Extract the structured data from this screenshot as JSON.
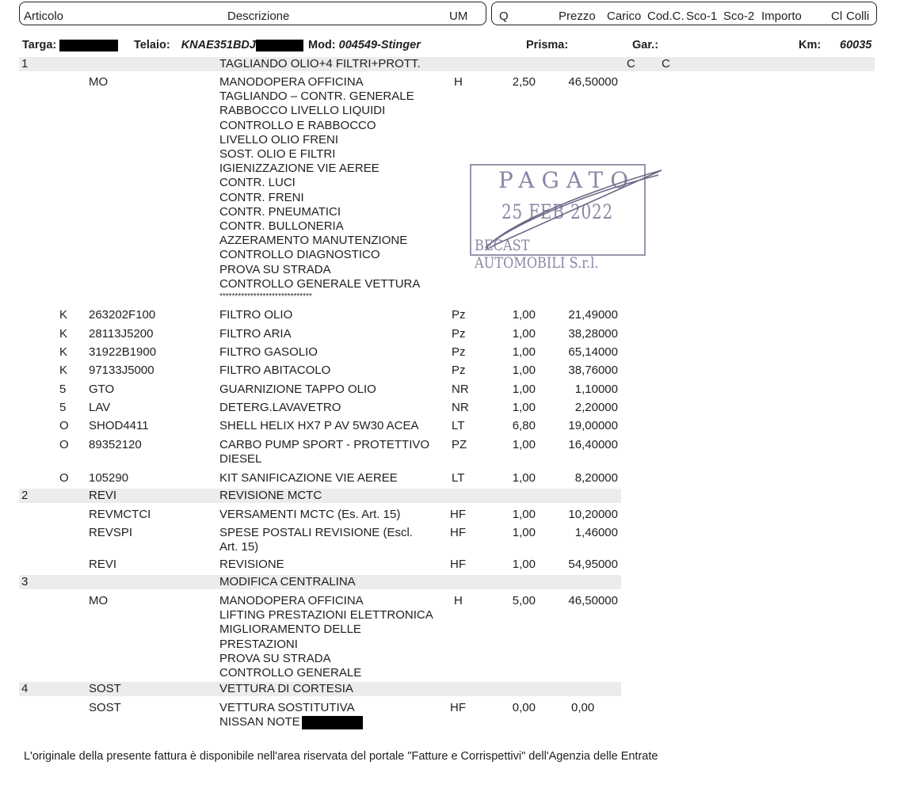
{
  "header": {
    "articolo": "Articolo",
    "descrizione": "Descrizione",
    "um": "UM",
    "q": "Q",
    "prezzo": "Prezzo",
    "carico": "Carico",
    "codc": "Cod.C.",
    "sco1": "Sco-1",
    "sco2": "Sco-2",
    "importo": "Importo",
    "cl": "Cl",
    "colli": "Colli"
  },
  "vehicle": {
    "targa_label": "Targa:",
    "telaio_label": "Telaio:",
    "telaio_value": "KNAE351BDJ",
    "mod_label": "Mod:",
    "mod_value": "004549-Stinger",
    "prisma_label": "Prisma:",
    "gar_label": "Gar.:",
    "km_label": "Km:",
    "km_value": "60035"
  },
  "groups": [
    {
      "num": "1",
      "title": "TAGLIANDO  OLIO+4 FILTRI+PROTT.",
      "codc": "C",
      "sco1": "C"
    },
    {
      "num": "2",
      "code": "REVI",
      "title": "REVISIONE MCTC"
    },
    {
      "num": "3",
      "title": "MODIFICA CENTRALINA"
    },
    {
      "num": "4",
      "code": "SOST",
      "title": "VETTURA DI CORTESIA"
    }
  ],
  "labour1": {
    "code": "MO",
    "lines": [
      "MANODOPERA OFFICINA",
      "TAGLIANDO – CONTR. GENERALE",
      "RABBOCCO LIVELLO LIQUIDI",
      "CONTROLLO E RABBOCCO",
      "LIVELLO OLIO FRENI",
      "SOST. OLIO E FILTRI",
      "IGIENIZZAZIONE VIE AEREE",
      "CONTR. LUCI",
      "CONTR. FRENI",
      "CONTR. PNEUMATICI",
      "CONTR. BULLONERIA",
      "AZZERAMENTO MANUTENZIONE",
      "CONTROLLO DIAGNOSTICO",
      "PROVA SU STRADA",
      "CONTROLLO GENERALE VETTURA"
    ],
    "stars": "******************************",
    "um": "H",
    "q": "2,50",
    "prezzo": "46,50000"
  },
  "items": [
    {
      "cl": "K",
      "code": "263202F100",
      "desc": "FILTRO OLIO",
      "um": "Pz",
      "q": "1,00",
      "prezzo": "21,49000"
    },
    {
      "cl": "K",
      "code": "28113J5200",
      "desc": "FILTRO ARIA",
      "um": "Pz",
      "q": "1,00",
      "prezzo": "38,28000"
    },
    {
      "cl": "K",
      "code": "31922B1900",
      "desc": "FILTRO GASOLIO",
      "um": "Pz",
      "q": "1,00",
      "prezzo": "65,14000"
    },
    {
      "cl": "K",
      "code": "97133J5000",
      "desc": "FILTRO ABITACOLO",
      "um": "Pz",
      "q": "1,00",
      "prezzo": "38,76000"
    },
    {
      "cl": "5",
      "code": "GTO",
      "desc": "GUARNIZIONE TAPPO OLIO",
      "um": "NR",
      "q": "1,00",
      "prezzo": "1,10000"
    },
    {
      "cl": "5",
      "code": "LAV",
      "desc": "DETERG.LAVAVETRO",
      "um": "NR",
      "q": "1,00",
      "prezzo": "2,20000"
    },
    {
      "cl": "O",
      "code": "SHOD4411",
      "desc": "SHELL HELIX HX7 P AV 5W30 ACEA",
      "um": "LT",
      "q": "6,80",
      "prezzo": "19,00000"
    },
    {
      "cl": "O",
      "code": "89352120",
      "desc": "CARBO PUMP SPORT - PROTETTIVO",
      "desc2": "DIESEL",
      "um": "PZ",
      "q": "1,00",
      "prezzo": "16,40000"
    },
    {
      "cl": "O",
      "code": "105290",
      "desc": "KIT SANIFICAZIONE VIE AEREE",
      "um": "LT",
      "q": "1,00",
      "prezzo": "8,20000"
    }
  ],
  "revisione": [
    {
      "code": "REVMCTCI",
      "desc": "VERSAMENTI MCTC (Es. Art. 15)",
      "um": "HF",
      "q": "1,00",
      "prezzo": "10,20000"
    },
    {
      "code": "REVSPI",
      "desc": "SPESE POSTALI REVISIONE (Escl.",
      "desc2": "Art. 15)",
      "um": "HF",
      "q": "1,00",
      "prezzo": "1,46000"
    },
    {
      "code": "REVI",
      "desc": "REVISIONE",
      "um": "HF",
      "q": "1,00",
      "prezzo": "54,95000"
    }
  ],
  "labour3": {
    "code": "MO",
    "lines": [
      "MANODOPERA OFFICINA",
      "LIFTING PRESTAZIONI ELETTRONICA",
      "MIGLIORAMENTO DELLE",
      "PRESTAZIONI",
      "PROVA SU STRADA",
      "CONTROLLO GENERALE"
    ],
    "um": "H",
    "q": "5,00",
    "prezzo": "46,50000"
  },
  "sost": {
    "code": "SOST",
    "desc": "VETTURA SOSTITUTIVA",
    "desc2": "NISSAN NOTE",
    "um": "HF",
    "q": "0,00",
    "prezzo": "0,00"
  },
  "stamp": {
    "line1": "PAGATO",
    "line2": "25 FEB 2022",
    "line3": "BECAST AUTOMOBILI S.r.l.",
    "color": "#8c86a6"
  },
  "footer": "L'originale della presente fattura è disponibile nell'area riservata del portale \"Fatture e Corrispettivi\" dell'Agenzia delle Entrate"
}
